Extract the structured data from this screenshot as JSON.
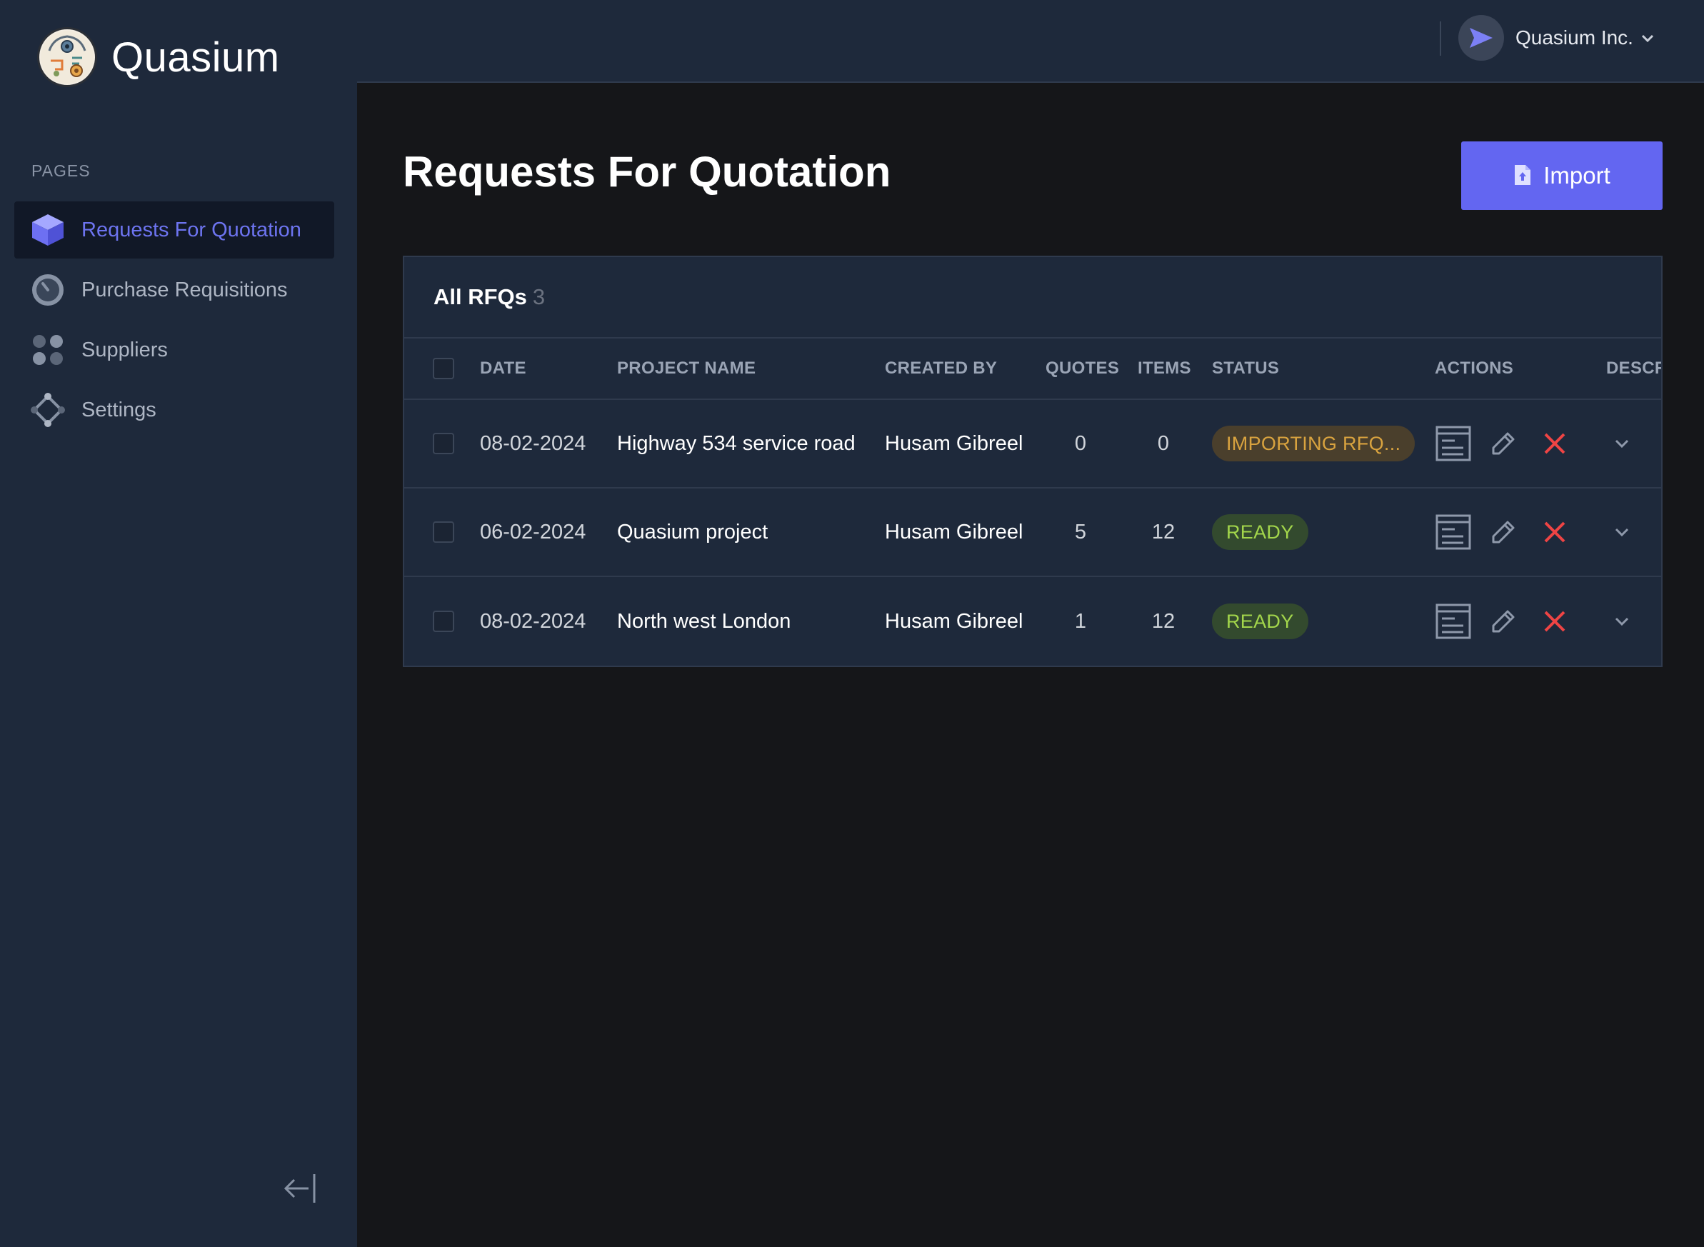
{
  "brand": {
    "name": "Quasium"
  },
  "sidebar": {
    "section_label": "PAGES",
    "items": [
      {
        "label": "Requests For Quotation",
        "icon": "cube-icon",
        "active": true
      },
      {
        "label": "Purchase Requisitions",
        "icon": "gauge-icon",
        "active": false
      },
      {
        "label": "Suppliers",
        "icon": "dots-grid-icon",
        "active": false
      },
      {
        "label": "Settings",
        "icon": "nodes-icon",
        "active": false
      }
    ],
    "collapse_icon": "collapse-left-icon"
  },
  "topbar": {
    "org_name": "Quasium Inc."
  },
  "page": {
    "title": "Requests For Quotation",
    "import_label": "Import"
  },
  "table_card": {
    "title": "All RFQs",
    "count": "3",
    "columns": {
      "date": "DATE",
      "project": "PROJECT NAME",
      "created_by": "CREATED BY",
      "quotes": "QUOTES",
      "items": "ITEMS",
      "status": "STATUS",
      "actions": "ACTIONS",
      "description": "DESCR"
    },
    "rows": [
      {
        "date": "08-02-2024",
        "project": "Highway 534 service road",
        "created_by": "Husam Gibreel",
        "quotes": "0",
        "items": "0",
        "status": "IMPORTING RFQ...",
        "status_type": "importing"
      },
      {
        "date": "06-02-2024",
        "project": "Quasium project",
        "created_by": "Husam Gibreel",
        "quotes": "5",
        "items": "12",
        "status": "READY",
        "status_type": "ready"
      },
      {
        "date": "08-02-2024",
        "project": "North west London",
        "created_by": "Husam Gibreel",
        "quotes": "1",
        "items": "12",
        "status": "READY",
        "status_type": "ready"
      }
    ]
  },
  "colors": {
    "accent": "#6366f1",
    "sidebar_bg": "#1e293b",
    "main_bg": "#151619",
    "status_importing": "#d9a33f",
    "status_ready": "#a3d64b",
    "delete": "#ef4444"
  }
}
